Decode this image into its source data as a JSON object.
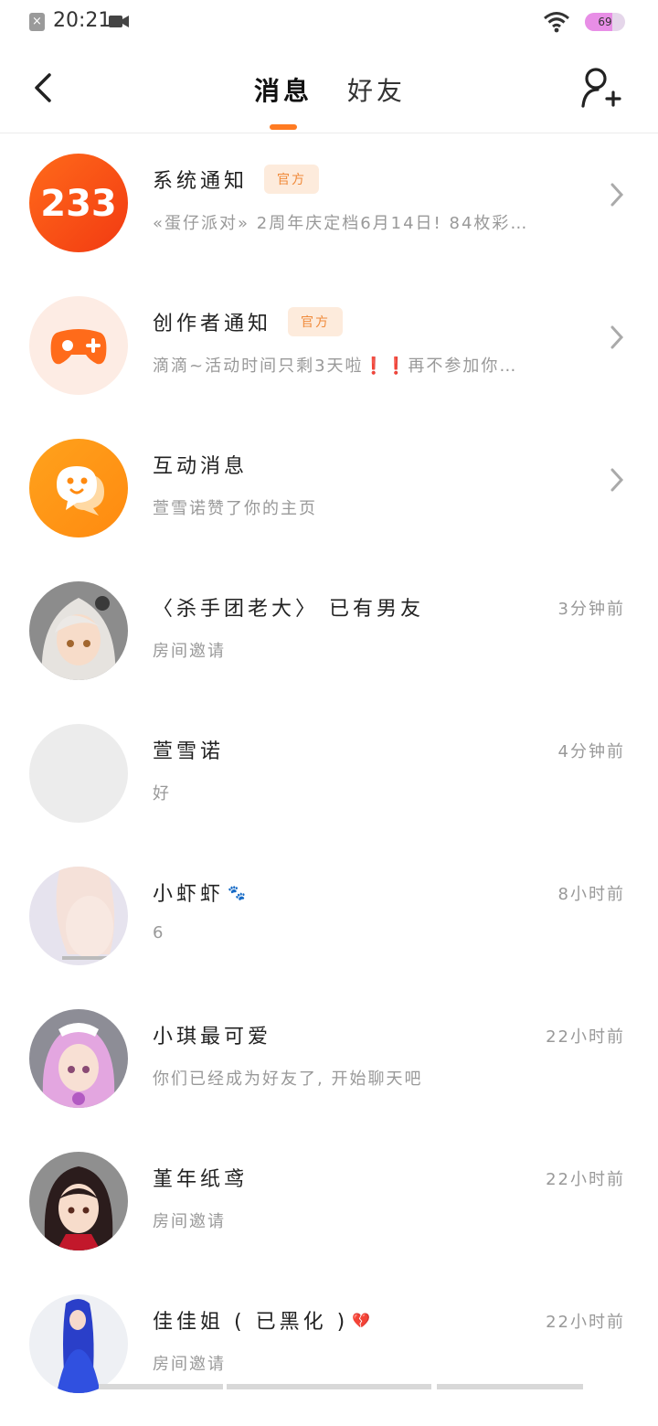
{
  "status_bar": {
    "time": "20:21",
    "battery": "69",
    "battery_level": 0.69
  },
  "header": {
    "tabs": [
      {
        "label": "消息",
        "active": true
      },
      {
        "label": "好友",
        "active": false
      }
    ],
    "accent_color": "#ff7b22"
  },
  "messages": [
    {
      "name": "系统通知",
      "badge": "官方",
      "preview": "«蛋仔派对» 2周年庆定档6月14日! 84枚彩…",
      "icon": "233-logo"
    },
    {
      "name": "创作者通知",
      "badge": "官方",
      "preview": "滴滴~活动时间只剩3天啦❗❗再不参加你…",
      "icon": "gamepad-icon"
    },
    {
      "name": "互动消息",
      "preview": "萱雪诺赞了你的主页",
      "icon": "chat-bubble-icon"
    },
    {
      "name": "〈杀手团老大〉 已有男友",
      "preview": "房间邀请",
      "time": "3分钟前"
    },
    {
      "name": "萱雪诺",
      "preview": "好",
      "time": "4分钟前"
    },
    {
      "name": "小虾虾",
      "emoji": "🐾",
      "preview": "6",
      "time": "8小时前"
    },
    {
      "name": "小琪最可爱",
      "preview": "你们已经成为好友了, 开始聊天吧",
      "time": "22小时前"
    },
    {
      "name": "堇年纸鸢",
      "preview": "房间邀请",
      "time": "22小时前"
    },
    {
      "name": "佳佳姐 ( 已黑化 )",
      "emoji": "💔",
      "preview": "房间邀请",
      "time": "22小时前"
    }
  ]
}
